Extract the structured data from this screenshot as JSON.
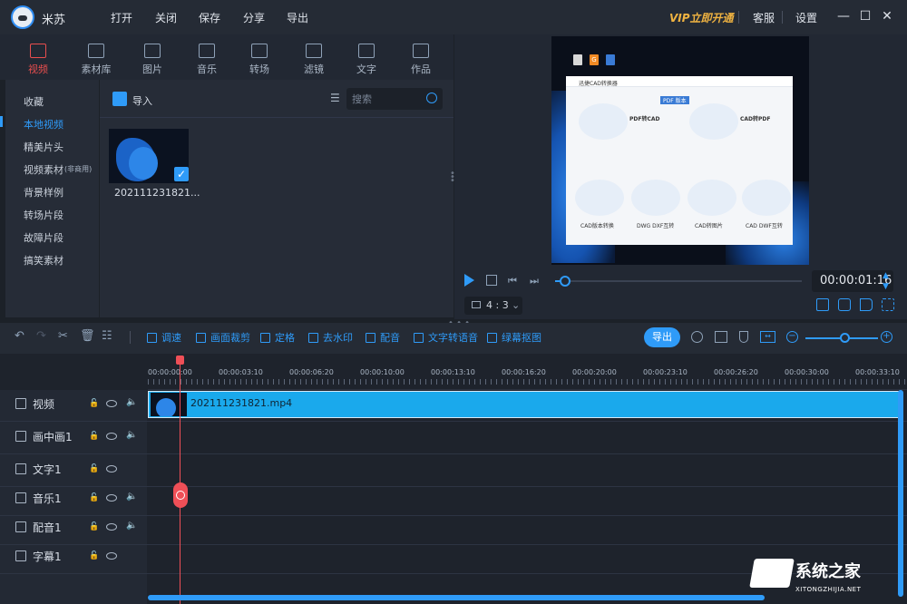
{
  "app": {
    "name": "米苏"
  },
  "menu": [
    "打开",
    "关闭",
    "保存",
    "分享",
    "导出"
  ],
  "titlebar": {
    "vip": "VIP立即开通",
    "service": "客服",
    "settings": "设置"
  },
  "media_tabs": [
    {
      "label": "视频",
      "icon": "film-icon"
    },
    {
      "label": "素材库",
      "icon": "library-icon"
    },
    {
      "label": "图片",
      "icon": "image-icon"
    },
    {
      "label": "音乐",
      "icon": "music-icon"
    },
    {
      "label": "转场",
      "icon": "transition-icon"
    },
    {
      "label": "滤镜",
      "icon": "filter-icon"
    },
    {
      "label": "文字",
      "icon": "text-icon"
    },
    {
      "label": "作品",
      "icon": "folder-icon"
    }
  ],
  "categories": [
    "收藏",
    "本地视频",
    "精美片头",
    "视频素材",
    "背景样例",
    "转场片段",
    "故障片段",
    "搞笑素材"
  ],
  "category_badge": "(非商用)",
  "library": {
    "import_label": "导入",
    "search_placeholder": "搜索",
    "thumb_name": "202111231821...",
    "thumb_checked": "✓"
  },
  "preview": {
    "timecode": "00:00:01:16",
    "aspect": "4 : 3",
    "progress": 0.04,
    "window_title": "迅捷CAD转换器",
    "cards": [
      "PDF转CAD",
      "CAD转PDF",
      "CAD版本转换",
      "DWG DXF互转",
      "CAD转图片",
      "CAD DWF互转"
    ],
    "badge": "PDF 版本",
    "dock_badge": "G"
  },
  "toolbar": {
    "tools": [
      "调速",
      "画面裁剪",
      "定格",
      "去水印",
      "配音",
      "文字转语音",
      "绿幕抠图"
    ],
    "export": "导出",
    "zoom": 0.55
  },
  "timeline": {
    "ticks": [
      "00:00:00:00",
      "00:00:03:10",
      "00:00:06:20",
      "00:00:10:00",
      "00:00:13:10",
      "00:00:16:20",
      "00:00:20:00",
      "00:00:23:10",
      "00:00:26:20",
      "00:00:30:00",
      "00:00:33:10"
    ],
    "tracks": [
      {
        "name": "视频",
        "icon": "film-icon",
        "audio": true
      },
      {
        "name": "画中画1",
        "icon": "pip-icon",
        "audio": true
      },
      {
        "name": "文字1",
        "icon": "text-icon",
        "audio": false
      },
      {
        "name": "音乐1",
        "icon": "music-icon",
        "audio": true
      },
      {
        "name": "配音1",
        "icon": "mic-icon",
        "audio": true
      },
      {
        "name": "字幕1",
        "icon": "subtitle-icon",
        "audio": false
      }
    ],
    "clip_name": "202111231821.mp4"
  },
  "watermark": {
    "title": "系统之家",
    "url": "XITONGZHIJIA.NET"
  },
  "colors": {
    "accent": "#2f9bf8",
    "active_tab": "#e84e4e",
    "vip": "#f0b341",
    "playhead": "#ef4f57"
  }
}
